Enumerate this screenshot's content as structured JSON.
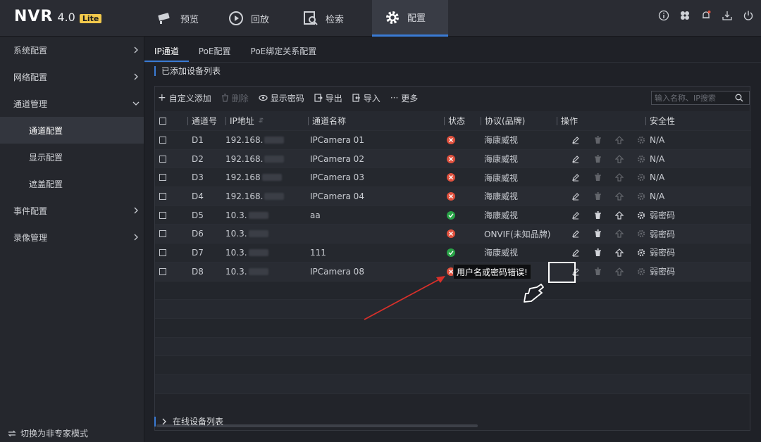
{
  "header": {
    "logo_text": "NVR",
    "version": "4.0",
    "edition": "Lite",
    "nav": [
      {
        "label": "预览",
        "icon": "camera-icon"
      },
      {
        "label": "回放",
        "icon": "playback-icon"
      },
      {
        "label": "检索",
        "icon": "search-file-icon"
      },
      {
        "label": "配置",
        "icon": "gear-icon",
        "active": true
      }
    ],
    "icons": [
      "info-icon",
      "fan-icon",
      "bell-icon",
      "download-icon",
      "power-icon"
    ]
  },
  "sidebar": {
    "items": [
      {
        "label": "系统配置"
      },
      {
        "label": "网络配置"
      },
      {
        "label": "通道管理",
        "expanded": true
      },
      {
        "label": "通道配置",
        "active": true
      },
      {
        "label": "显示配置"
      },
      {
        "label": "遮盖配置"
      },
      {
        "label": "事件配置"
      },
      {
        "label": "录像管理"
      }
    ],
    "bottom": "切换为非专家模式"
  },
  "tabs": [
    {
      "label": "IP通道",
      "active": true
    },
    {
      "label": "PoE配置"
    },
    {
      "label": "PoE绑定关系配置"
    }
  ],
  "section_title": "已添加设备列表",
  "toolbar": {
    "custom_add": "自定义添加",
    "delete": "删除",
    "show_password": "显示密码",
    "export": "导出",
    "import": "导入",
    "more": "更多",
    "search_placeholder": "输入名称、IP搜索"
  },
  "columns": {
    "no": "通道号",
    "ip": "IP地址",
    "name": "通道名称",
    "status": "状态",
    "protocol": "协议(品牌)",
    "ops": "操作",
    "security": "安全性"
  },
  "rows": [
    {
      "no": "D1",
      "ip": "192.168.",
      "name": "IPCamera 01",
      "status": "error",
      "protocol": "海康威视",
      "security": "N/A",
      "ops_enabled": false
    },
    {
      "no": "D2",
      "ip": "192.168.",
      "name": "IPCamera 02",
      "status": "error",
      "protocol": "海康威视",
      "security": "N/A",
      "ops_enabled": false
    },
    {
      "no": "D3",
      "ip": "192.168",
      "name": "IPCamera 03",
      "status": "error",
      "protocol": "海康威视",
      "security": "N/A",
      "ops_enabled": false
    },
    {
      "no": "D4",
      "ip": "192.168.",
      "name": "IPCamera 04",
      "status": "error",
      "protocol": "海康威视",
      "security": "N/A",
      "ops_enabled": false
    },
    {
      "no": "D5",
      "ip": "10.3.",
      "name": "aa",
      "status": "ok",
      "protocol": "海康威视",
      "security": "弱密码",
      "ops_enabled": true
    },
    {
      "no": "D6",
      "ip": "10.3.",
      "name": "",
      "status": "error",
      "protocol": "ONVIF(未知品牌)",
      "security": "弱密码",
      "ops_enabled": "partial"
    },
    {
      "no": "D7",
      "ip": "10.3.",
      "name": "111",
      "status": "ok",
      "protocol": "海康威视",
      "security": "弱密码",
      "ops_enabled": true
    },
    {
      "no": "D8",
      "ip": "10.3.",
      "name": "IPCamera 08",
      "status": "error",
      "protocol": "",
      "security": "弱密码",
      "ops_enabled": false
    }
  ],
  "tooltip": "用户名或密码错误!",
  "online_section": "在线设备列表",
  "colors": {
    "accent": "#3a7bd5",
    "error": "#e0513e",
    "ok": "#29a347",
    "annotation_arrow": "#d9302a"
  }
}
